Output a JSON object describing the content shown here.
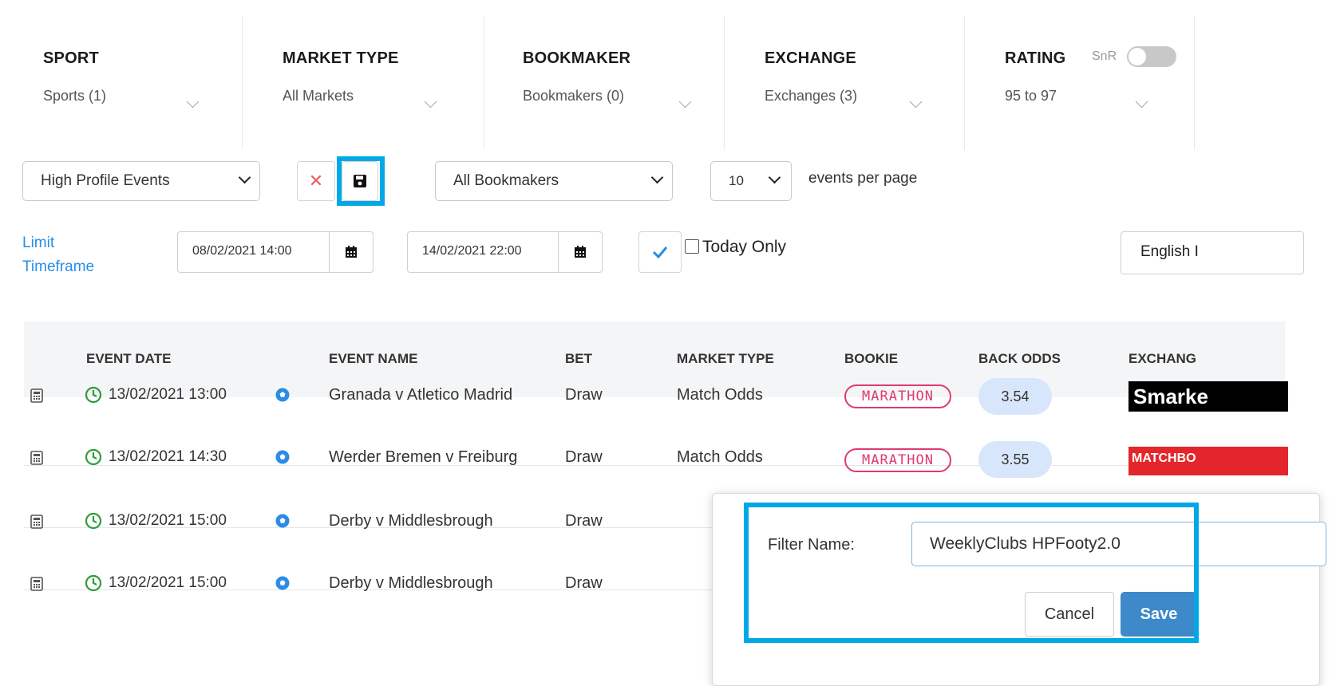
{
  "filters": [
    {
      "title": "SPORT",
      "value": "Sports (1)"
    },
    {
      "title": "MARKET TYPE",
      "value": "All Markets"
    },
    {
      "title": "BOOKMAKER",
      "value": "Bookmakers (0)"
    },
    {
      "title": "EXCHANGE",
      "value": "Exchanges (3)"
    },
    {
      "title": "RATING",
      "value": "95 to 97"
    }
  ],
  "snr_label": "SnR",
  "toolbar": {
    "saved_filter": "High Profile Events",
    "bookmaker_select": "All Bookmakers",
    "per_page_value": "10",
    "per_page_label": "events per page"
  },
  "timeframe": {
    "link_line1": "Limit",
    "link_line2": "Timeframe",
    "start": "08/02/2021 14:00",
    "end": "14/02/2021 22:00",
    "today_only": "Today Only",
    "language": "English I"
  },
  "table": {
    "headers": [
      "EVENT DATE",
      "EVENT NAME",
      "BET",
      "MARKET TYPE",
      "BOOKIE",
      "BACK ODDS",
      "EXCHANG"
    ],
    "rows": [
      {
        "date": "13/02/2021 13:00",
        "event": "Granada v Atletico Madrid",
        "bet": "Draw",
        "market": "Match Odds",
        "bookie": "MARATHON",
        "odds": "3.54",
        "exchange": "Smarke"
      },
      {
        "date": "13/02/2021 14:30",
        "event": "Werder Bremen v Freiburg",
        "bet": "Draw",
        "market": "Match Odds",
        "bookie": "MARATHON",
        "odds": "3.55",
        "exchange": "MATCHBO"
      },
      {
        "date": "13/02/2021 15:00",
        "event": "Derby v Middlesbrough",
        "bet": "Draw"
      },
      {
        "date": "13/02/2021 15:00",
        "event": "Derby v Middlesbrough",
        "bet": "Draw"
      }
    ]
  },
  "popover": {
    "label": "Filter Name:",
    "value": "WeeklyClubs HPFooty2.0",
    "cancel": "Cancel",
    "save": "Save"
  },
  "colors": {
    "highlight": "#00a8e6",
    "link": "#2a8ce6",
    "clock": "#2e9b3a",
    "soccer": "#2a8ce6",
    "save_button": "#3d89c9",
    "odds_pill": "#d8e6fb",
    "marathon": "#e03a70"
  }
}
